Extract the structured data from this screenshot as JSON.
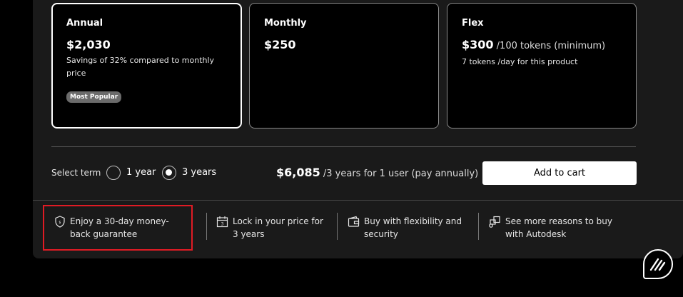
{
  "plans": [
    {
      "name": "Annual",
      "price": "$2,030",
      "unit": "",
      "desc": "Savings of 32% compared to monthly price",
      "badge": "Most Popular"
    },
    {
      "name": "Monthly",
      "price": "$250",
      "unit": "",
      "desc": ""
    },
    {
      "name": "Flex",
      "price": "$300",
      "unit": " /100 tokens (minimum)",
      "desc": "7 tokens /day for this product"
    }
  ],
  "term": {
    "label": "Select term",
    "options": [
      "1 year",
      "3 years"
    ],
    "selected": "3 years"
  },
  "total": {
    "amount": "$6,085",
    "detail": " /3 years for 1 user (pay annually)"
  },
  "cart": {
    "label": "Add to cart"
  },
  "features": [
    {
      "icon": "shield-money-icon",
      "text": "Enjoy a 30-day money-back guarantee"
    },
    {
      "icon": "calendar-icon",
      "text": "Lock in your price for 3 years"
    },
    {
      "icon": "wallet-icon",
      "text": "Buy with flexibility and security"
    },
    {
      "icon": "boxes-icon",
      "text": "See more reasons to buy with Autodesk"
    }
  ],
  "colors": {
    "highlight": "#e01b24",
    "background": "#000000",
    "panel": "#1a1a1a"
  }
}
